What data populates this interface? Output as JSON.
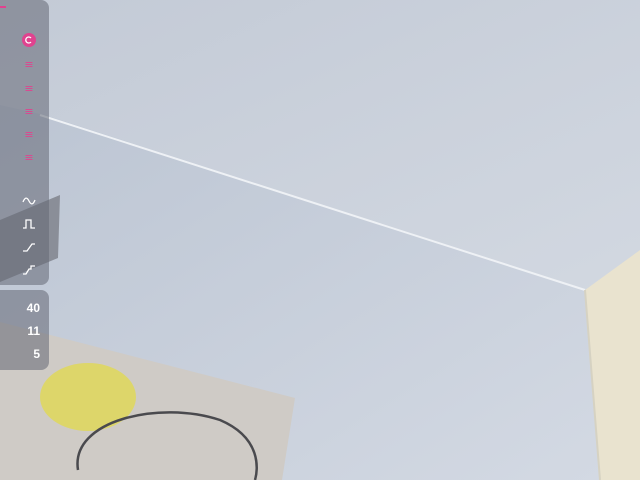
{
  "toolbar": {
    "accent_color": "#e0438f",
    "buttons": [
      {
        "name": "record-button",
        "icon": "record-icon"
      },
      {
        "name": "menu-button-1",
        "icon": "lines-icon"
      },
      {
        "name": "menu-button-2",
        "icon": "lines-icon"
      },
      {
        "name": "menu-button-3",
        "icon": "lines-icon"
      },
      {
        "name": "menu-button-4",
        "icon": "lines-icon"
      },
      {
        "name": "menu-button-5",
        "icon": "lines-icon"
      }
    ],
    "waveforms": [
      {
        "name": "sine-wave-button",
        "icon": "sine-wave-icon"
      },
      {
        "name": "square-wave-button",
        "icon": "square-wave-icon"
      },
      {
        "name": "ramp-wave-button",
        "icon": "ramp-wave-icon"
      },
      {
        "name": "step-wave-button",
        "icon": "step-wave-icon"
      }
    ]
  },
  "levels": {
    "values": [
      "40",
      "11",
      "5"
    ]
  }
}
